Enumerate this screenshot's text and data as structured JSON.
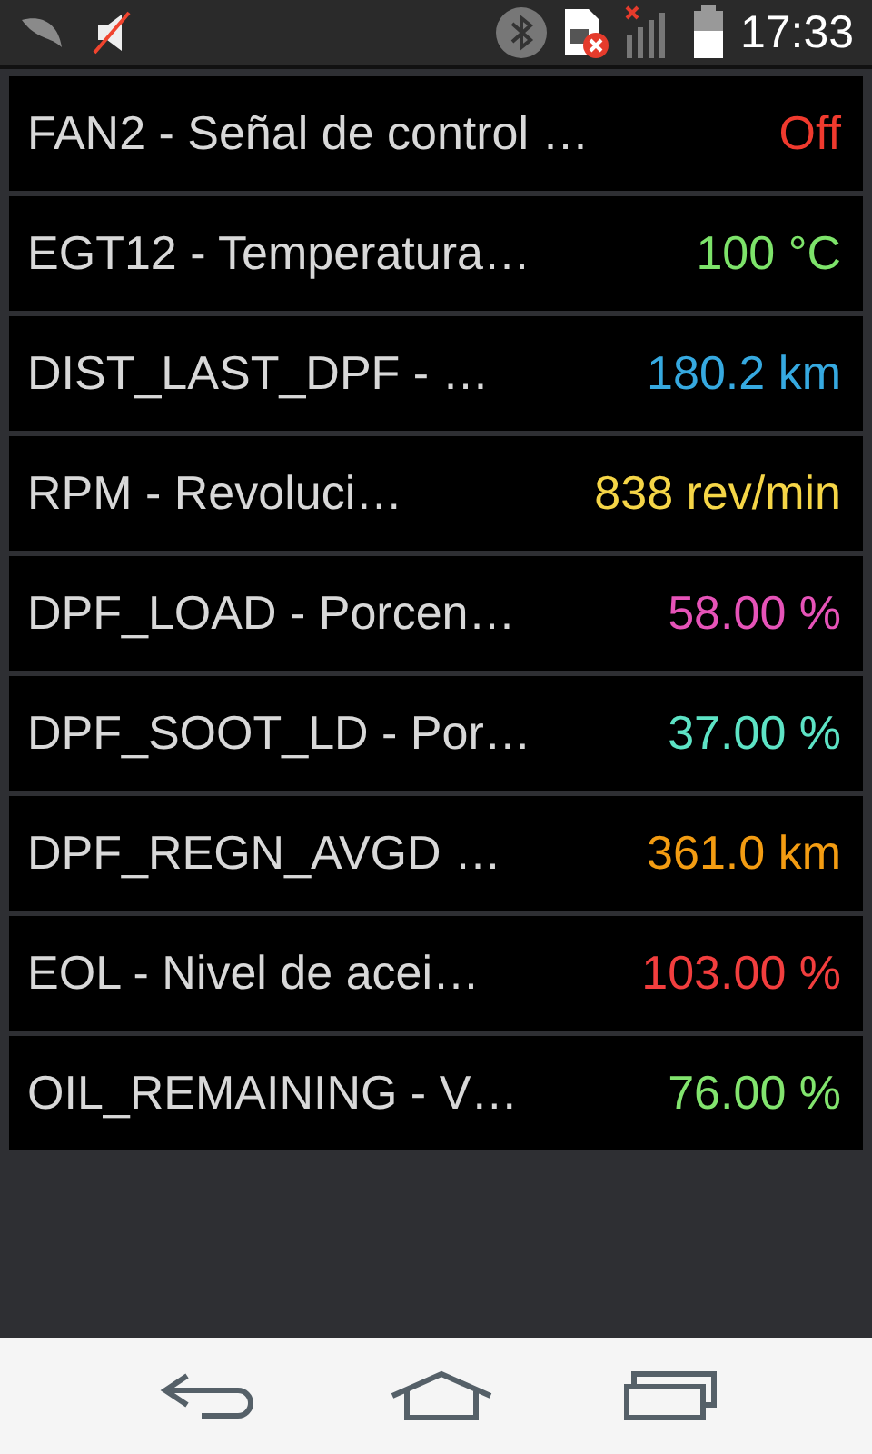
{
  "status_bar": {
    "time": "17:33"
  },
  "rows": [
    {
      "label": "FAN2 - Señal de control …",
      "value": "Off",
      "color": "#f03a2e"
    },
    {
      "label": "EGT12 - Temperatura…",
      "value": "100 °C",
      "color": "#7de36a"
    },
    {
      "label": "DIST_LAST_DPF - …",
      "value": "180.2 km",
      "color": "#36a9e0"
    },
    {
      "label": "RPM - Revoluci…",
      "value": "838 rev/min",
      "color": "#f5d547"
    },
    {
      "label": "DPF_LOAD - Porcen…",
      "value": "58.00 %",
      "color": "#e653b8"
    },
    {
      "label": "DPF_SOOT_LD - Por…",
      "value": "37.00 %",
      "color": "#5de3c5"
    },
    {
      "label": "DPF_REGN_AVGD …",
      "value": "361.0 km",
      "color": "#f39c12"
    },
    {
      "label": "EOL - Nivel de acei…",
      "value": "103.00 %",
      "color": "#f23e3e"
    },
    {
      "label": "OIL_REMAINING - V…",
      "value": "76.00 %",
      "color": "#82e46e"
    }
  ]
}
